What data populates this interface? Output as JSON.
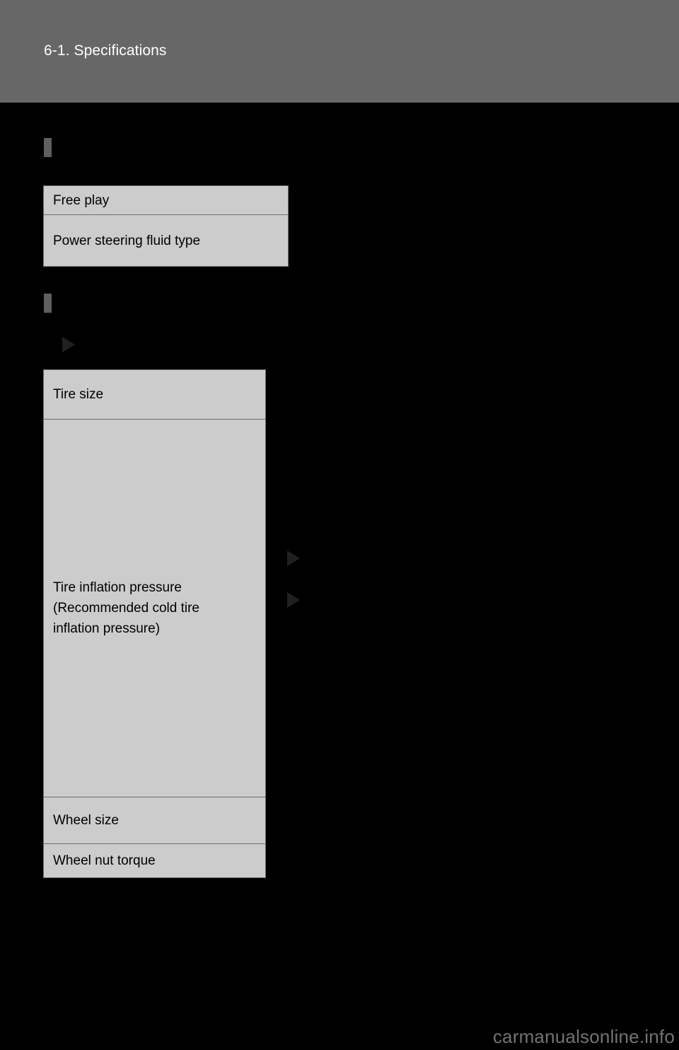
{
  "page": {
    "header_title": "6-1. Specifications",
    "background_color": "#000000",
    "header_band_color": "#676767",
    "table_fill_color": "#cccccc",
    "table_border_color": "#6d6d6d",
    "marker_color": "#5f5f5f",
    "triangle_color": "#231f20"
  },
  "sections": [
    {
      "marker": "section-bar-marker",
      "table": {
        "rows": [
          {
            "label": "Free play"
          },
          {
            "label": "Power steering fluid type"
          }
        ]
      }
    },
    {
      "marker": "section-bar-marker",
      "sub_marker": "triangle-marker",
      "table": {
        "rows": [
          {
            "label": "Tire size"
          },
          {
            "label": "Tire inflation pressure\n(Recommended cold tire\ninflation pressure)"
          },
          {
            "label": "Wheel size"
          },
          {
            "label": "Wheel nut torque"
          }
        ]
      },
      "side_markers": [
        {
          "name": "triangle-marker"
        },
        {
          "name": "triangle-marker"
        }
      ]
    }
  ],
  "footer": {
    "watermark": "carmanualsonline.info"
  }
}
